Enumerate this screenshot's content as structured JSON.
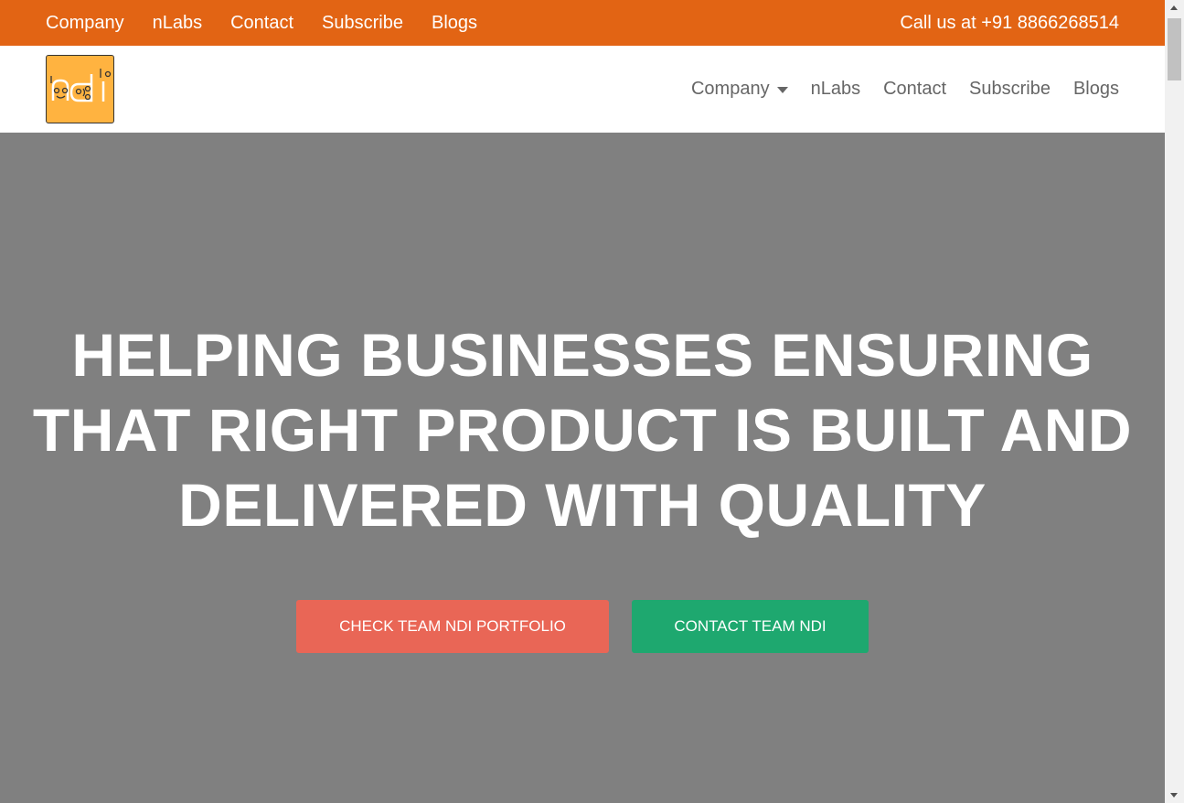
{
  "topbar": {
    "links": [
      "Company",
      "nLabs",
      "Contact",
      "Subscribe",
      "Blogs"
    ],
    "phone": "Call us at +91 8866268514",
    "color": "#e26414"
  },
  "navbar": {
    "logo_icon": "ndi-logo",
    "company_label": "Company",
    "links": [
      "nLabs",
      "Contact",
      "Subscribe",
      "Blogs"
    ]
  },
  "hero": {
    "headline": "HELPING BUSINESSES ENSURING THAT RIGHT PRODUCT IS BUILT AND DELIVERED WITH QUALITY",
    "portfolio_button": "CHECK TEAM NDI PORTFOLIO",
    "contact_button": "CONTACT TEAM NDI",
    "background_color": "#808080",
    "portfolio_color": "#e96656",
    "contact_color": "#1ea86f"
  }
}
